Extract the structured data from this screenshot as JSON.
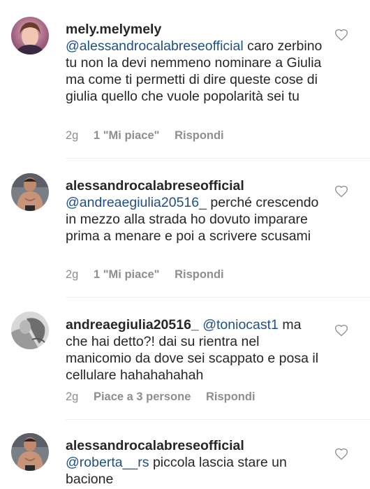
{
  "comments": [
    {
      "username": "mely.melymely",
      "mention": "@alessandrocalabreseofficial",
      "text": "caro zerbino tu non la devi nemmeno nominare a Giulia ma come ti permetti di dire queste cose di giulia quello che vuole popolarità sei tu",
      "time": "2g",
      "likes": "1 \"Mi piace\"",
      "reply": "Rispondi"
    },
    {
      "username": "alessandrocalabreseofficial",
      "mention": "@andreaegiulia20516_",
      "text": "perché crescendo in mezzo alla strada ho dovuto imparare prima a menare e poi a scrivere scusami",
      "time": "2g",
      "likes": "1 \"Mi piace\"",
      "reply": "Rispondi"
    },
    {
      "username": "andreaegiulia20516_",
      "mention": "@toniocast1",
      "text": "ma che hai detto?! dai su rientra nel manicomio da dove sei scappato e posa il cellulare hahahahahah",
      "time": "2g",
      "likes": "Piace a 3 persone",
      "reply": "Rispondi"
    },
    {
      "username": "alessandrocalabreseofficial",
      "mention": "@roberta__rs",
      "text": "piccola lascia stare un bacione"
    }
  ],
  "colors": {
    "mention": "#1f4f87",
    "meta": "#8e8e8e",
    "text": "#262626"
  },
  "icons": {
    "like": "heart-outline-icon"
  }
}
